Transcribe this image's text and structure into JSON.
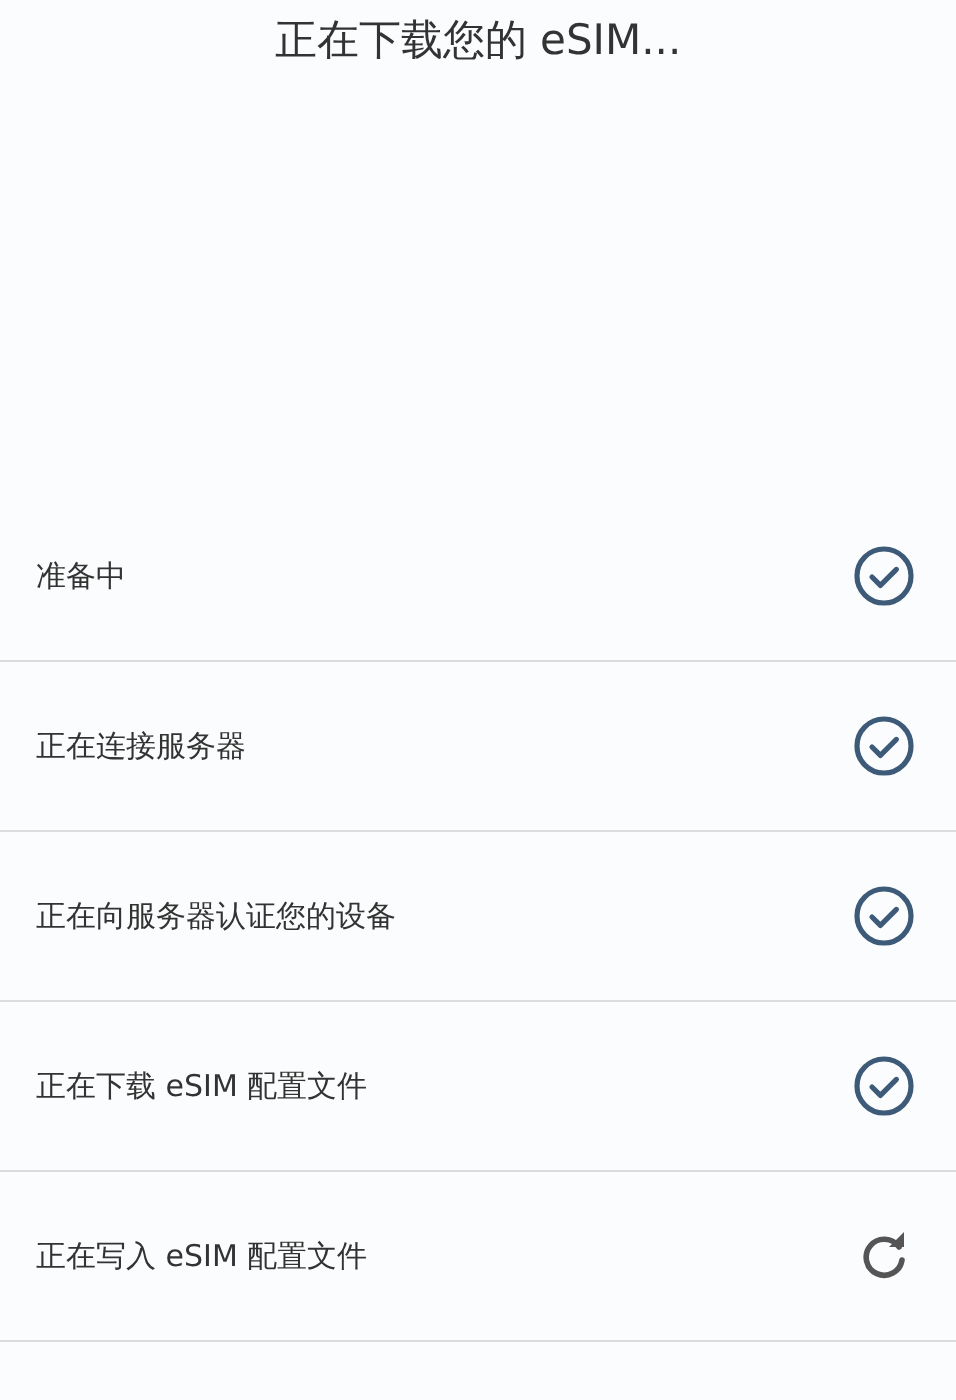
{
  "title": "正在下载您的 eSIM...",
  "steps": [
    {
      "label": "准备中",
      "done": true
    },
    {
      "label": "正在连接服务器",
      "done": true
    },
    {
      "label": "正在向服务器认证您的设备",
      "done": true
    },
    {
      "label": "正在下载 eSIM 配置文件",
      "done": true
    },
    {
      "label": "正在写入 eSIM 配置文件",
      "done": false
    }
  ]
}
